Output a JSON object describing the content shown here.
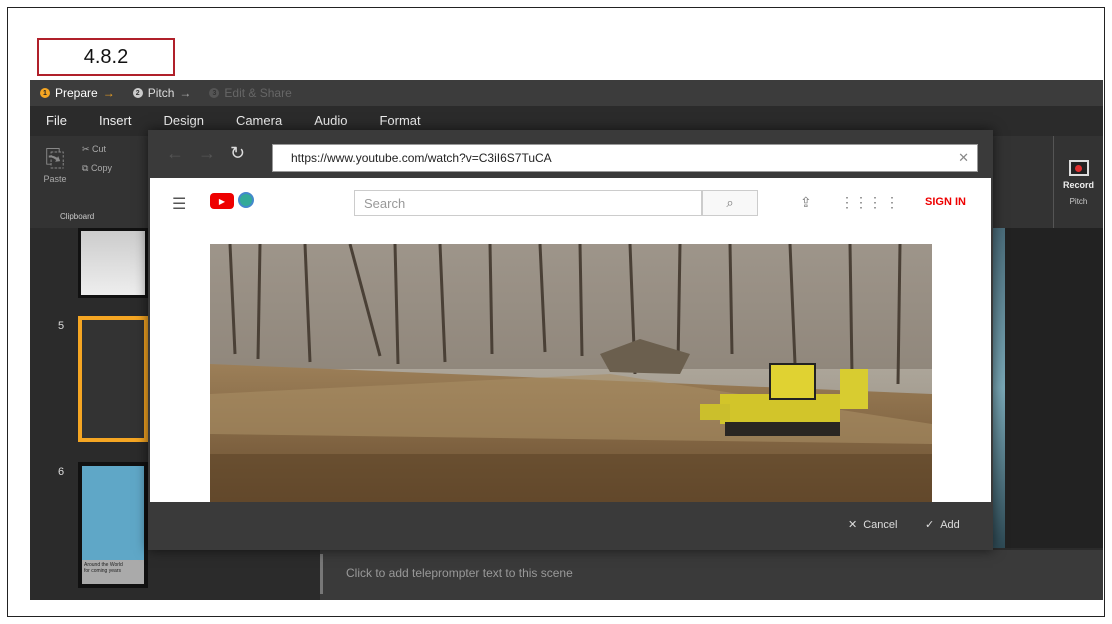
{
  "version_label": "4.8.2",
  "workflow": {
    "steps": [
      {
        "num": "1",
        "label": "Prepare",
        "arrow": "→"
      },
      {
        "num": "2",
        "label": "Pitch",
        "arrow": "→"
      },
      {
        "num": "3",
        "label": "Edit & Share",
        "arrow": ""
      }
    ]
  },
  "menu": [
    "File",
    "Insert",
    "Design",
    "Camera",
    "Audio",
    "Format"
  ],
  "ribbon": {
    "paste": "Paste",
    "cut": "Cut",
    "copy": "Copy",
    "clipboard_group": "Clipboard",
    "record": "Record",
    "pitch_group": "Pitch"
  },
  "scenes": [
    "5",
    "6"
  ],
  "thumb_caption": "Around the World\nfor coming years",
  "browser": {
    "url": "https://www.youtube.com/watch?v=C3iI6S7TuCA",
    "search_placeholder": "Search",
    "signin": "SIGN IN"
  },
  "dialog": {
    "cancel": "Cancel",
    "add": "Add"
  },
  "teleprompter_placeholder": "Click to add teleprompter text to this scene",
  "icons": [
    "back-arrow-icon",
    "forward-arrow-icon",
    "refresh-icon",
    "close-icon",
    "hamburger-icon",
    "youtube-logo-icon",
    "globe-icon",
    "search-icon",
    "upload-icon",
    "apps-grid-icon",
    "more-vert-icon",
    "record-icon",
    "checkmark-icon"
  ]
}
